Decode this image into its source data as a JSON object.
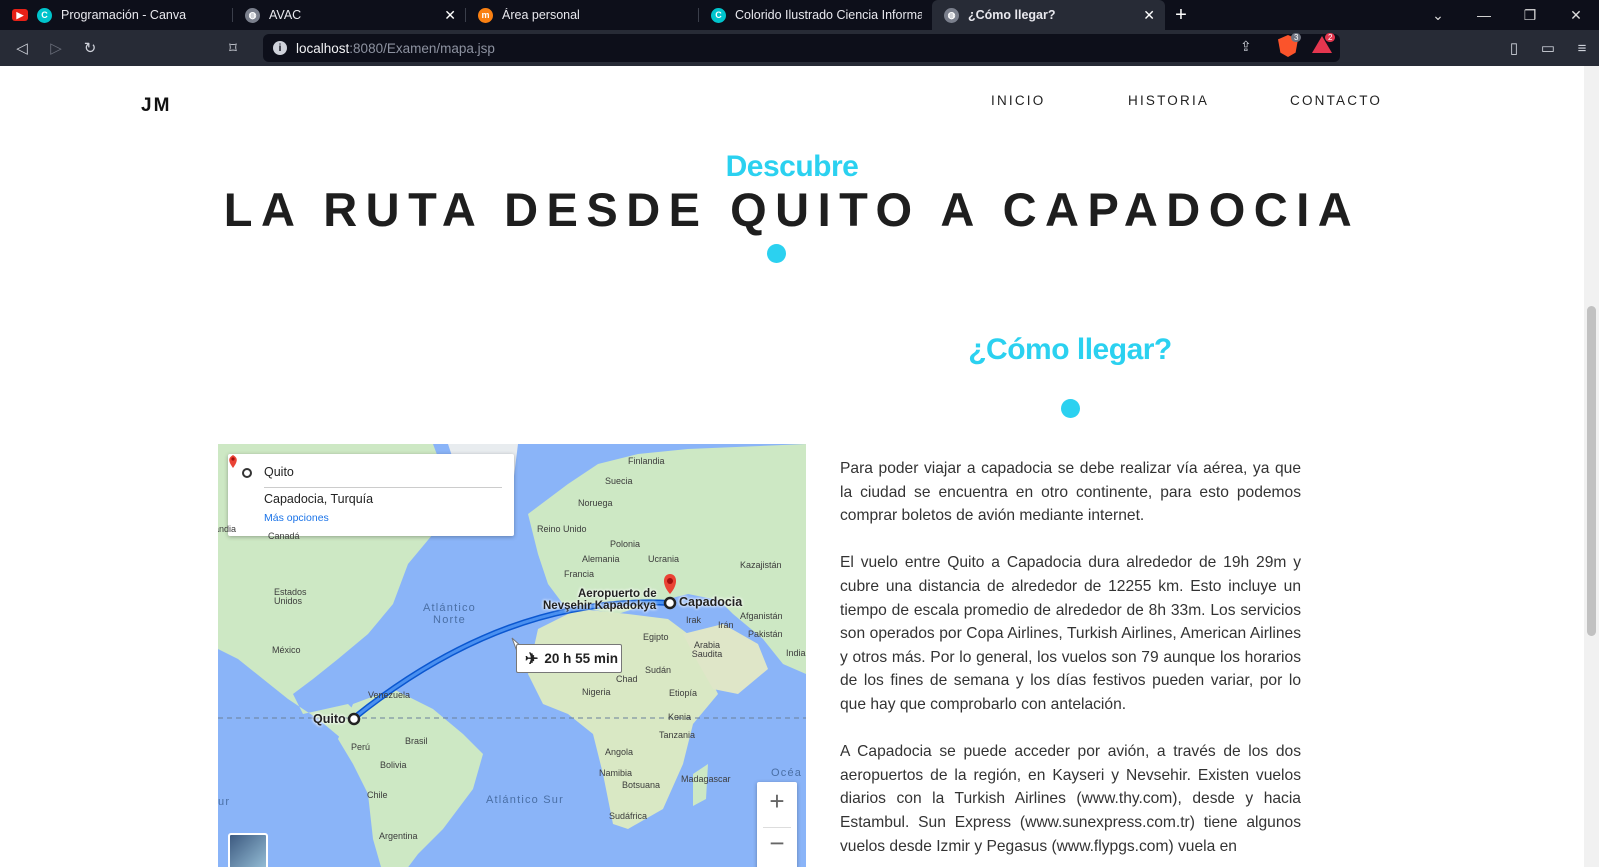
{
  "browser": {
    "tabs": [
      {
        "title": "Programación - Canva",
        "favicon": "canva-icon",
        "active": false,
        "closable": false
      },
      {
        "title": "AVAC",
        "favicon": "globe-icon",
        "active": false,
        "closable": true
      },
      {
        "title": "Área personal",
        "favicon": "moodle-icon",
        "active": false,
        "closable": false
      },
      {
        "title": "Colorido Ilustrado Ciencia Información",
        "favicon": "canva-icon",
        "active": false,
        "closable": false
      },
      {
        "title": "¿Cómo llegar?",
        "favicon": "globe-icon",
        "active": true,
        "closable": true
      }
    ],
    "url_host": "localhost",
    "url_rest": ":8080/Examen/mapa.jsp",
    "brave_shield_count": "3",
    "rewards_count": "2",
    "colors": {
      "tabbar": "#0d0f1a",
      "toolbar": "#272b36"
    }
  },
  "site": {
    "logo": "JM",
    "nav": [
      {
        "label": "INICIO"
      },
      {
        "label": "HISTORIA"
      },
      {
        "label": "CONTACTO"
      }
    ]
  },
  "hero": {
    "kicker": "Descubre",
    "title": "LA RUTA DESDE QUITO A CAPADOCIA"
  },
  "section": {
    "title": "¿Cómo llegar?",
    "paragraphs": [
      "Para poder viajar a capadocia se debe realizar vía aérea, ya que la ciudad se encuentra en otro continente, para esto podemos comprar boletos de avión mediante internet.",
      "El vuelo entre Quito a Capadocia dura alrededor de 19h 29m y cubre una distancia de alrededor de 12255 km. Esto incluye un tiempo de escala promedio de alrededor de 8h 33m. Los servicios son operados por Copa Airlines, Turkish Airlines, American Airlines y otros más. Por lo general, los vuelos son 79 aunque los horarios de los fines de semana y los días festivos pueden variar, por lo que hay que comprobarlo con antelación.",
      "A Capadocia se puede acceder por avión, a través de los dos aeropuertos de la región, en Kayseri y Nevsehir. Existen vuelos diarios con la Turkish Airlines (www.thy.com), desde y hacia Estambul. Sun Express (www.sunexpress.com.tr) tiene algunos vuelos desde Izmir y Pegasus (www.flypgs.com) vuela en"
    ]
  },
  "map": {
    "origin": "Quito",
    "destination": "Capadocia, Turquía",
    "more_options": "Más opciones",
    "flight_duration": "20 h 55 min",
    "city_origin": "Quito",
    "city_destination": "Capadocia",
    "airport_line1": "Aeropuerto de",
    "airport_line2": "Nevşehir Kapadokya",
    "ocean_north": "Atlántico\nNorte",
    "ocean_south": "Atlántico Sur",
    "ocean_edge": "Océa",
    "ocean_left": "ur",
    "countries": [
      "Finlandia",
      "Suecia",
      "Noruega",
      "Reino Unido",
      "Polonia",
      "Alemania",
      "Ucrania",
      "Francia",
      "Kazajistán",
      "Estados Unidos",
      "México",
      "Egipto",
      "Irak",
      "Irán",
      "Afganistán",
      "Pakistán",
      "Arabia Saudita",
      "India",
      "Sudán",
      "Chad",
      "Nigeria",
      "Etiopía",
      "Kenia",
      "Tanzania",
      "Angola",
      "Namibia",
      "Botsuana",
      "Madagascar",
      "Sudáfrica",
      "Venezuela",
      "Perú",
      "Brasil",
      "Bolivia",
      "Chile",
      "Argentina",
      "Canadá",
      "andia"
    ],
    "zoom_in": "+",
    "zoom_out": "−",
    "colors": {
      "water": "#8ab4f8",
      "land": "#cde8c4",
      "route": "#1a73e8",
      "pin": "#ea4335"
    }
  },
  "colors": {
    "accent": "#2bd1f0",
    "heading": "#1e1e1e",
    "text": "#333333"
  }
}
